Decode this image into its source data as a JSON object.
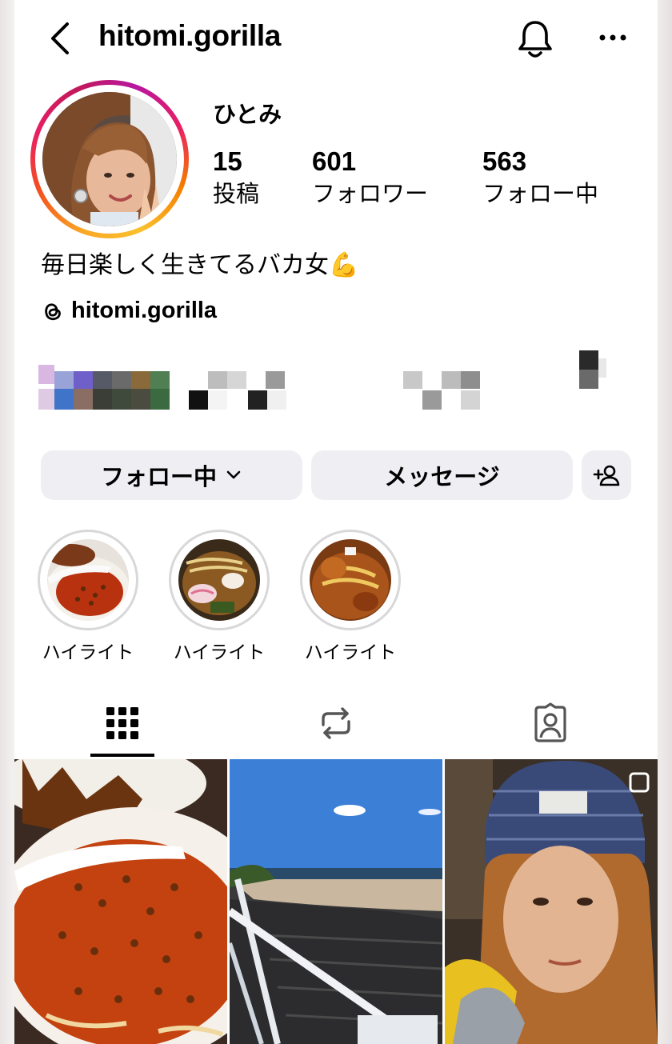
{
  "header": {
    "username": "hitomi.gorilla",
    "icons": [
      "back-arrow-icon",
      "bell-icon",
      "more-icon"
    ]
  },
  "profile": {
    "display_name": "ひとみ",
    "stats": [
      {
        "value": "15",
        "label": "投稿"
      },
      {
        "value": "601",
        "label": "フォロワー"
      },
      {
        "value": "563",
        "label": "フォロー中"
      }
    ],
    "bio": "毎日楽しく生きてるバカ女💪",
    "threads_handle": "hitomi.gorilla",
    "avatar_ring_colors": [
      "#f9a825",
      "#e91e63",
      "#b8179f"
    ]
  },
  "actions": {
    "follow_label": "フォロー中",
    "message_label": "メッセージ",
    "add_user_icon": "add-user-icon"
  },
  "highlights": [
    {
      "label": "ハイライト"
    },
    {
      "label": "ハイライト"
    },
    {
      "label": "ハイライト"
    }
  ],
  "tabs": [
    {
      "icon": "grid-icon",
      "active": true
    },
    {
      "icon": "reels-repost-icon",
      "active": false
    },
    {
      "icon": "tagged-icon",
      "active": false
    }
  ],
  "posts": [
    {
      "subject": "ramen bowl"
    },
    {
      "subject": "seaside rocks"
    },
    {
      "subject": "woman in knit beanie"
    }
  ]
}
